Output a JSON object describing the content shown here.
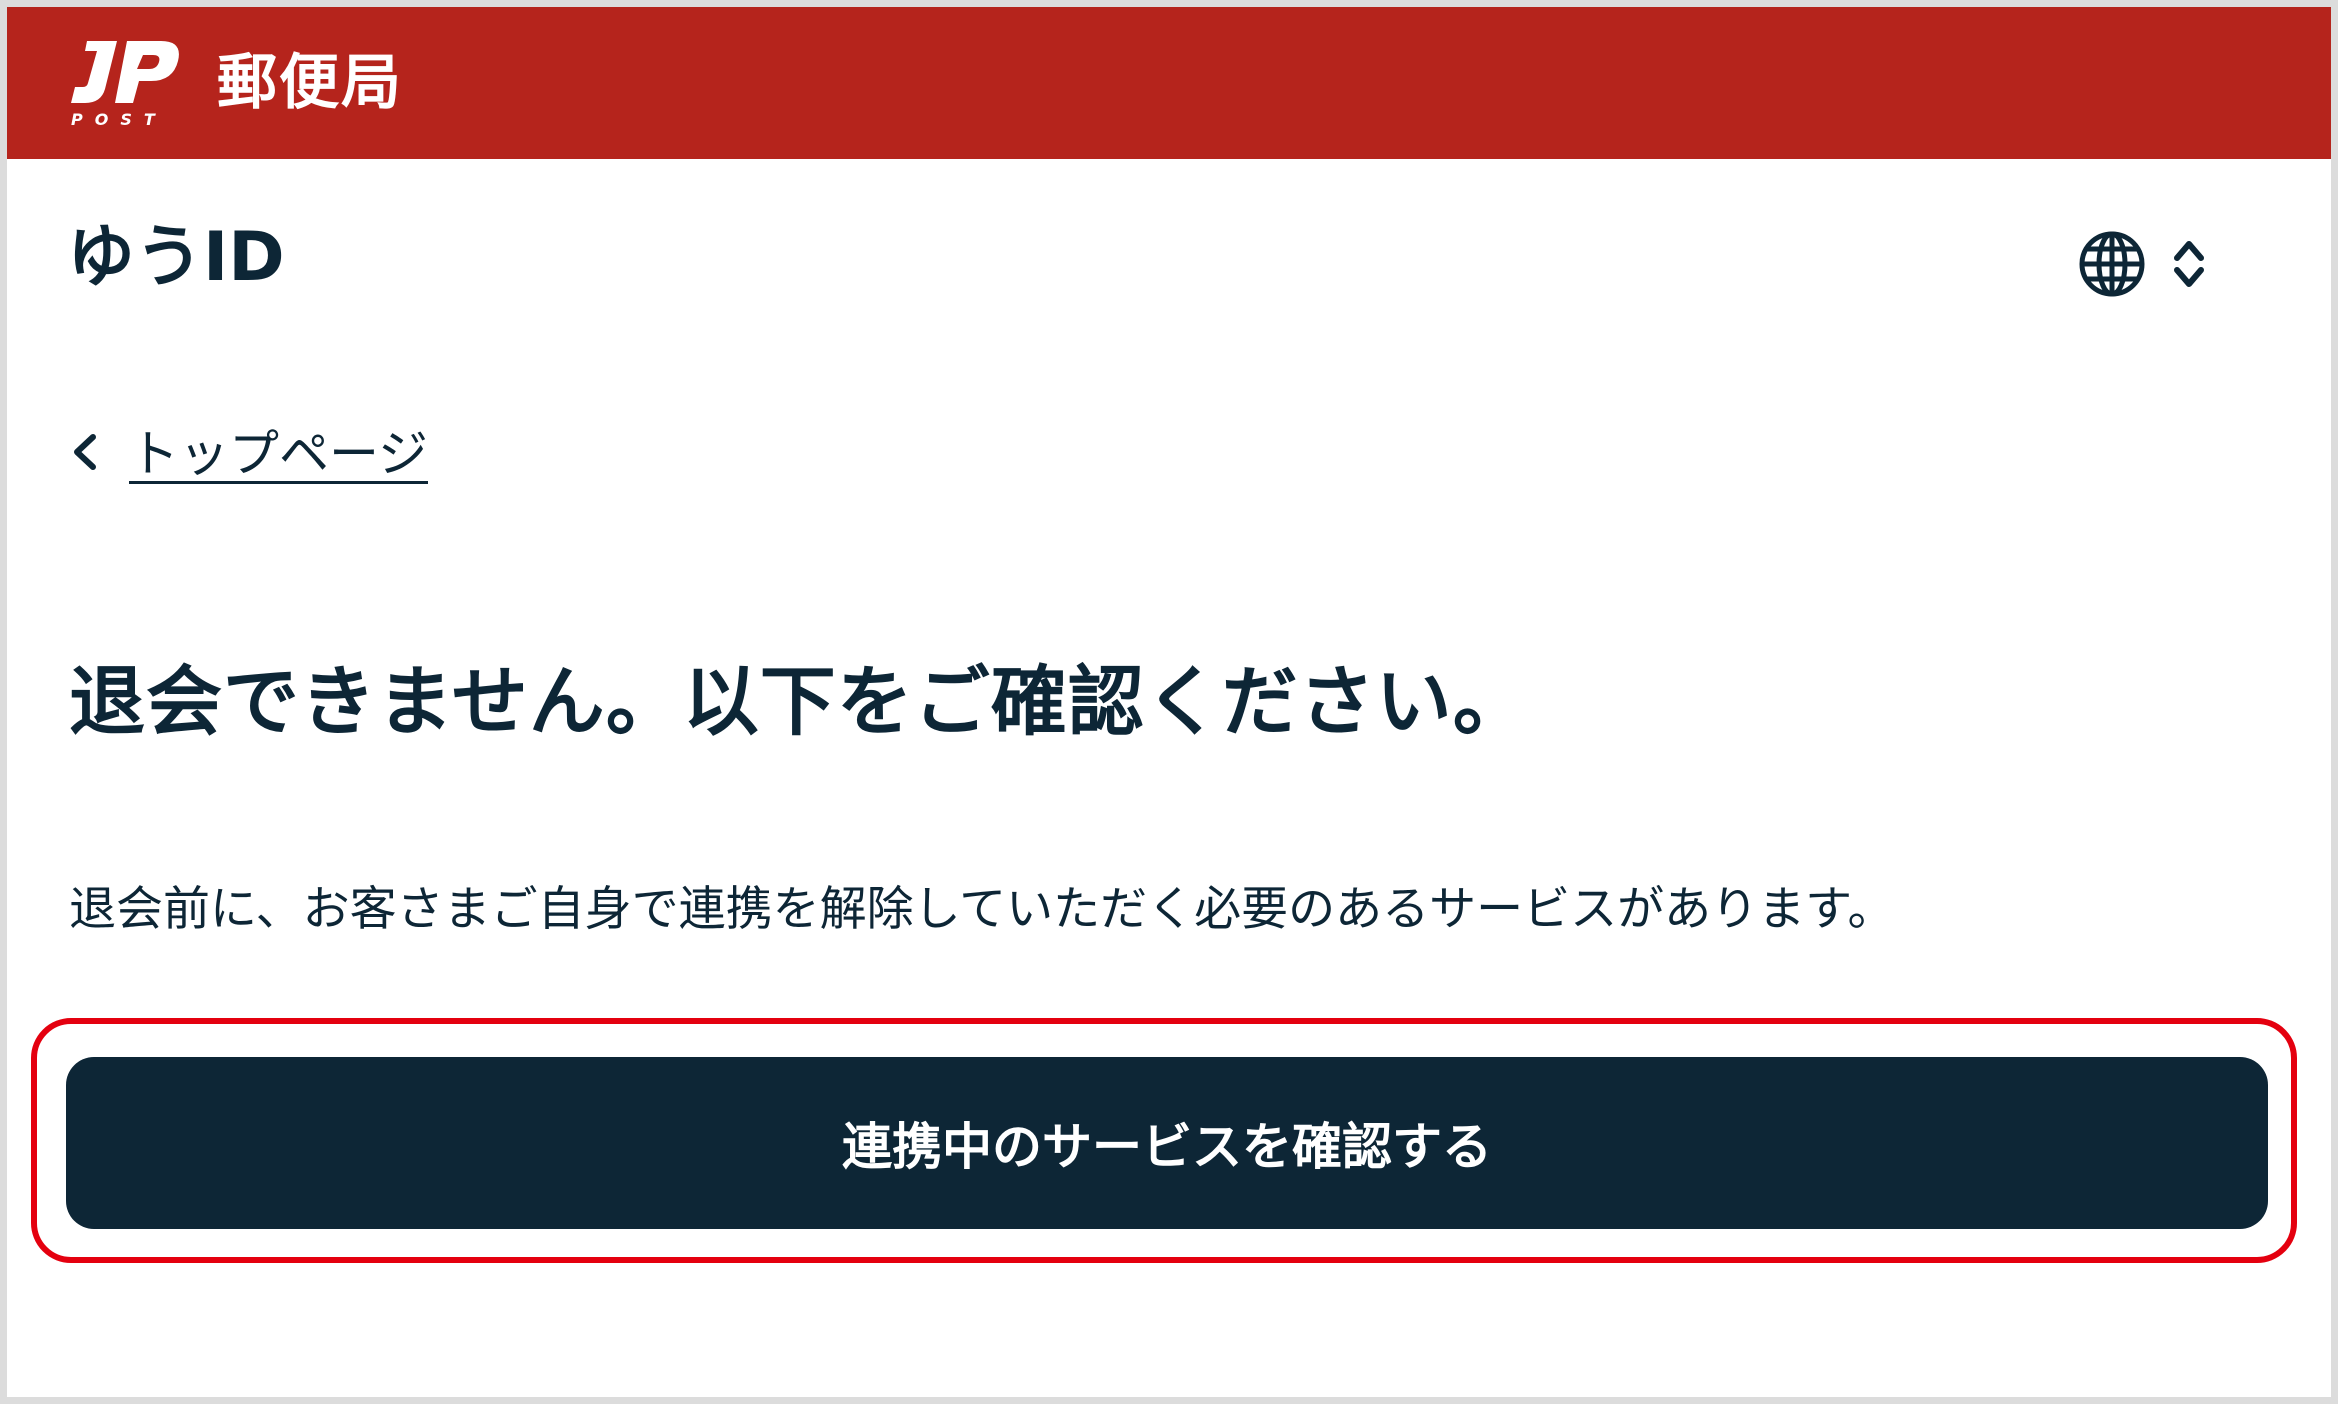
{
  "header": {
    "logo_icon": "jp-post-logo",
    "logo_text": "POST",
    "brand_name": "郵便局"
  },
  "app": {
    "title": "ゆうID",
    "language_icon": "globe-icon",
    "language_toggle_icon": "chevron-up-down-icon"
  },
  "breadcrumb": {
    "back_icon": "chevron-left-icon",
    "label": "トップページ"
  },
  "main": {
    "title": "退会できません。以下をご確認ください。",
    "description": "退会前に、お客さまご自身で連携を解除していただく必要のあるサービスがあります。",
    "primary_button": "連携中のサービスを確認する"
  },
  "colors": {
    "brand": "#b5241c",
    "text": "#0d2636",
    "button": "#0d2636",
    "highlight": "#e4000f"
  }
}
